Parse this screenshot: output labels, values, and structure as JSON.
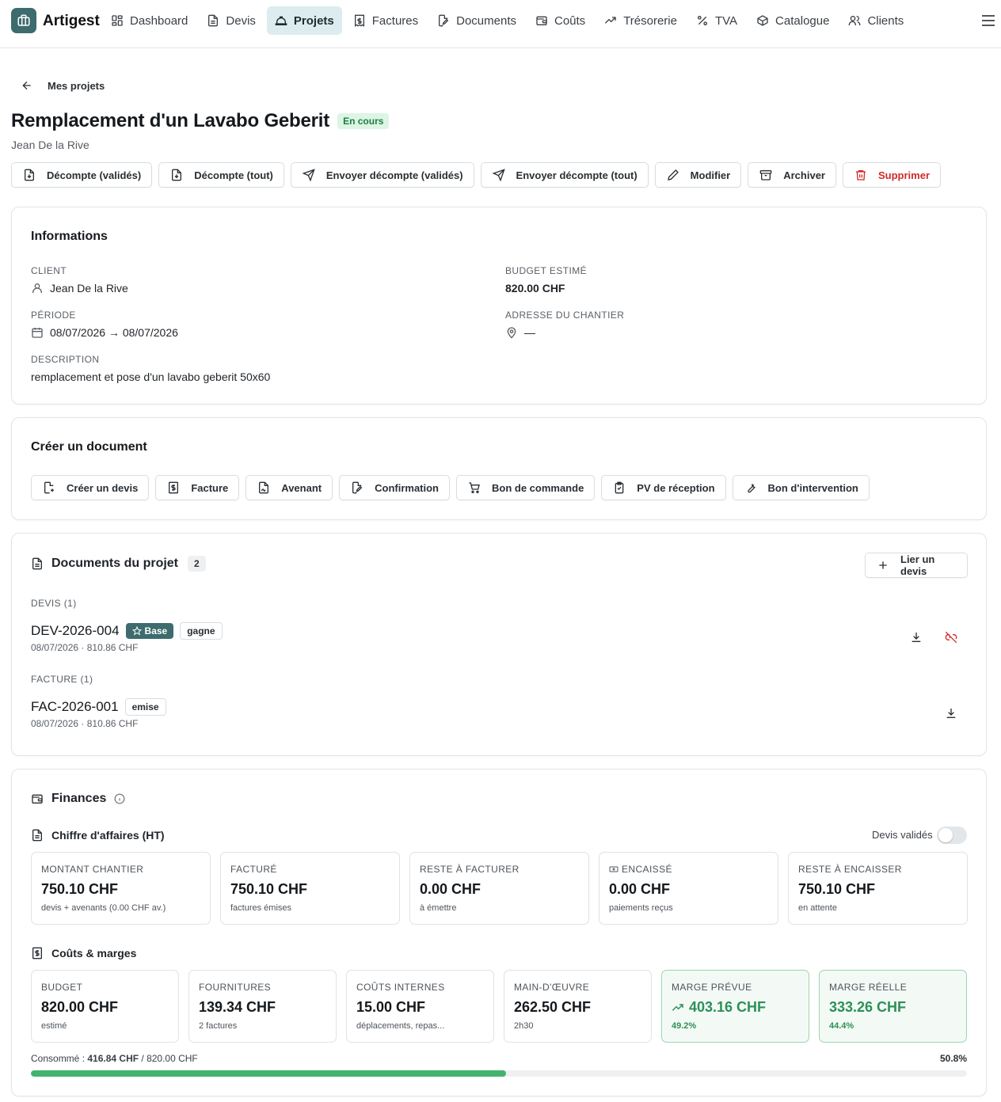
{
  "app": {
    "brand": "Artigest"
  },
  "nav": {
    "items": [
      {
        "label": "Dashboard",
        "icon": "dashboard-icon",
        "active": false
      },
      {
        "label": "Devis",
        "icon": "file-icon",
        "active": false
      },
      {
        "label": "Projets",
        "icon": "hard-hat-icon",
        "active": true
      },
      {
        "label": "Factures",
        "icon": "receipt-icon",
        "active": false
      },
      {
        "label": "Documents",
        "icon": "file-edit-icon",
        "active": false
      },
      {
        "label": "Coûts",
        "icon": "wallet-icon",
        "active": false
      },
      {
        "label": "Trésorerie",
        "icon": "trending-up-icon",
        "active": false
      },
      {
        "label": "TVA",
        "icon": "percent-icon",
        "active": false
      },
      {
        "label": "Catalogue",
        "icon": "package-icon",
        "active": false
      },
      {
        "label": "Clients",
        "icon": "users-icon",
        "active": false
      }
    ]
  },
  "breadcrumb": {
    "back_label": "Mes projets"
  },
  "project": {
    "title": "Remplacement d'un Lavabo Geberit",
    "status": "En cours",
    "client": "Jean De la Rive"
  },
  "actions": {
    "decompte_valides": "Décompte (validés)",
    "decompte_tout": "Décompte (tout)",
    "envoyer_valides": "Envoyer décompte (validés)",
    "envoyer_tout": "Envoyer décompte (tout)",
    "modifier": "Modifier",
    "archiver": "Archiver",
    "supprimer": "Supprimer"
  },
  "info": {
    "title": "Informations",
    "client_label": "CLIENT",
    "client_value": "Jean De la Rive",
    "budget_label": "BUDGET ESTIMÉ",
    "budget_value": "820.00 CHF",
    "periode_label": "PÉRIODE",
    "periode_value": "08/07/2026 → 08/07/2026",
    "adresse_label": "ADRESSE DU CHANTIER",
    "adresse_value": "—",
    "description_label": "DESCRIPTION",
    "description_value": "remplacement et pose d'un lavabo geberit 50x60"
  },
  "create_doc": {
    "title": "Créer un document",
    "buttons": {
      "devis": "Créer un devis",
      "facture": "Facture",
      "avenant": "Avenant",
      "confirmation": "Confirmation",
      "bon_commande": "Bon de commande",
      "pv_reception": "PV de réception",
      "bon_intervention": "Bon d'intervention"
    }
  },
  "documents": {
    "title": "Documents du projet",
    "count": "2",
    "link_button": "Lier un devis",
    "devis_section": "DEVIS (1)",
    "devis": {
      "number": "DEV-2026-004",
      "badge_base": "Base",
      "status": "gagne",
      "meta": "08/07/2026 · 810.86 CHF"
    },
    "facture_section": "FACTURE (1)",
    "facture": {
      "number": "FAC-2026-001",
      "status": "emise",
      "meta": "08/07/2026 · 810.86 CHF"
    }
  },
  "finances": {
    "title": "Finances",
    "ca_title": "Chiffre d'affaires (HT)",
    "toggle_label": "Devis validés",
    "toggle_on": false,
    "ca_stats": [
      {
        "label": "MONTANT CHANTIER",
        "value": "750.10 CHF",
        "sub": "devis + avenants (0.00 CHF av.)"
      },
      {
        "label": "FACTURÉ",
        "value": "750.10 CHF",
        "sub": "factures émises"
      },
      {
        "label": "RESTE À FACTURER",
        "value": "0.00 CHF",
        "sub": "à émettre"
      },
      {
        "label": "ENCAISSÉ",
        "value": "0.00 CHF",
        "sub": "paiements reçus"
      },
      {
        "label": "RESTE À ENCAISSER",
        "value": "750.10 CHF",
        "sub": "en attente"
      }
    ],
    "costs_title": "Coûts & marges",
    "cost_stats": [
      {
        "label": "BUDGET",
        "value": "820.00 CHF",
        "sub": "estimé"
      },
      {
        "label": "FOURNITURES",
        "value": "139.34 CHF",
        "sub": "2 factures"
      },
      {
        "label": "COÛTS INTERNES",
        "value": "15.00 CHF",
        "sub": "déplacements, repas..."
      },
      {
        "label": "MAIN-D'ŒUVRE",
        "value": "262.50 CHF",
        "sub": "2h30"
      },
      {
        "label": "MARGE PRÉVUE",
        "value": "403.16 CHF",
        "sub": "49.2%"
      },
      {
        "label": "MARGE RÉELLE",
        "value": "333.26 CHF",
        "sub": "44.4%"
      }
    ],
    "consumed_prefix": "Consommé : ",
    "consumed_value": "416.84 CHF",
    "consumed_total": " / 820.00 CHF",
    "consumed_percent": "50.8%",
    "consumed_fraction": 0.508,
    "accent_color": "#43b36f"
  }
}
